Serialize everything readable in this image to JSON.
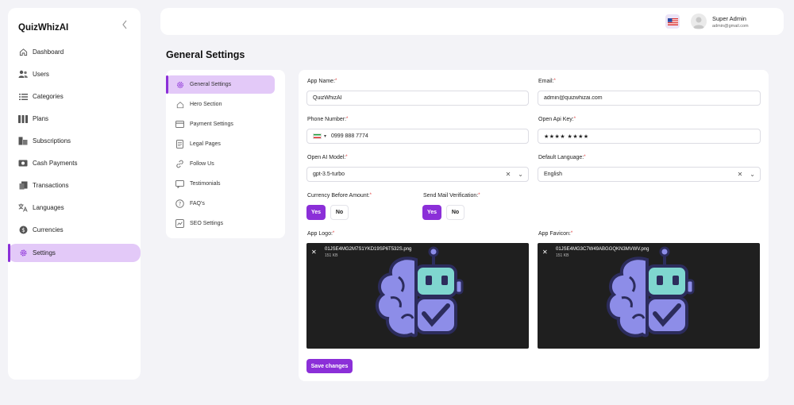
{
  "sidebar": {
    "brand": "QuizWhizAI",
    "items": [
      {
        "label": "Dashboard",
        "icon": "home-icon"
      },
      {
        "label": "Users",
        "icon": "users-icon"
      },
      {
        "label": "Categories",
        "icon": "list-icon"
      },
      {
        "label": "Plans",
        "icon": "columns-icon"
      },
      {
        "label": "Subscriptions",
        "icon": "subscriptions-icon"
      },
      {
        "label": "Cash Payments",
        "icon": "cash-icon"
      },
      {
        "label": "Transactions",
        "icon": "transactions-icon"
      },
      {
        "label": "Languages",
        "icon": "translate-icon"
      },
      {
        "label": "Currencies",
        "icon": "currency-icon"
      },
      {
        "label": "Settings",
        "icon": "gear-icon",
        "active": true
      }
    ]
  },
  "header": {
    "user_name": "Super Admin",
    "user_email": "admin@gmail.com"
  },
  "page_title": "General Settings",
  "subnav": [
    {
      "label": "General Settings",
      "icon": "gear-icon",
      "active": true
    },
    {
      "label": "Hero Section",
      "icon": "home-icon"
    },
    {
      "label": "Payment Settings",
      "icon": "card-icon"
    },
    {
      "label": "Legal Pages",
      "icon": "document-icon"
    },
    {
      "label": "Follow Us",
      "icon": "link-icon"
    },
    {
      "label": "Testimonials",
      "icon": "message-icon"
    },
    {
      "label": "FAQ's",
      "icon": "question-icon"
    },
    {
      "label": "SEO Settings",
      "icon": "seo-icon"
    }
  ],
  "form": {
    "app_name_label": "App Name:",
    "app_name_value": "QuizWhizAI",
    "email_label": "Email:",
    "email_value": "admin@quizwhizai.com",
    "phone_label": "Phone Number:",
    "phone_value": "0999 888 7774",
    "api_key_label": "Open Api Key:",
    "api_key_value": "★★★★ ★★★★",
    "ai_model_label": "Open AI Model:",
    "ai_model_value": "gpt-3.5-turbo",
    "language_label": "Default Language:",
    "language_value": "English",
    "currency_label": "Currency Before Amount:",
    "mail_label": "Send Mail Verification:",
    "yes": "Yes",
    "no": "No",
    "logo_label": "App Logo:",
    "logo_file": "01JSE4MG2M7S1YKD19SP6T532S.png",
    "logo_size": "151 KB",
    "favicon_label": "App Favicon:",
    "favicon_file": "01JSE4MG3C7W49ABGGQKN3MVWV.png",
    "favicon_size": "151 KB",
    "save_label": "Save changes",
    "required_mark": "*"
  },
  "colors": {
    "accent": "#8b2fd8",
    "active_bg": "#e3c9f8",
    "robot_teal": "#7fd6cf",
    "brain_purple": "#8d8de8"
  }
}
